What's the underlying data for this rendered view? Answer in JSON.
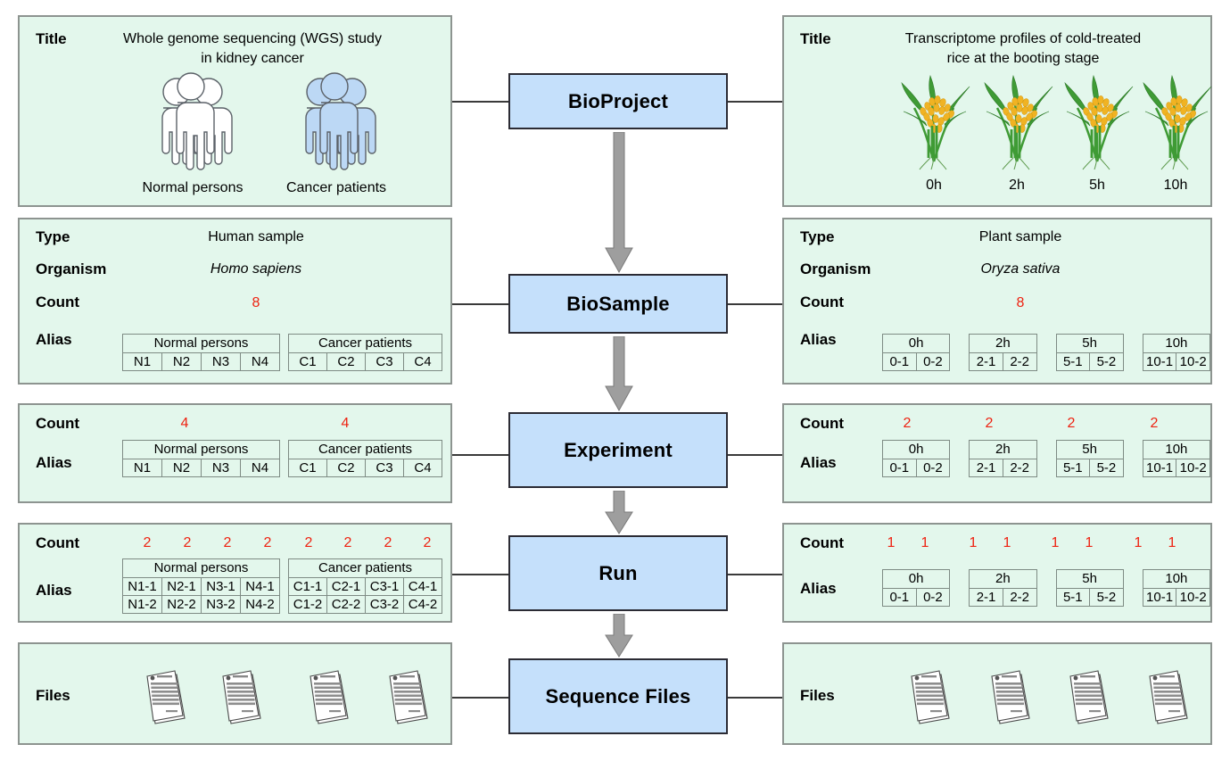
{
  "colors": {
    "panel_bg": "#e3f7ec",
    "panel_border": "#8d9490",
    "stage_box_bg": "#c5e0fb",
    "stage_box_border": "#2b2b34",
    "count_red": "#ee2211",
    "arrow_gray": "#9e9e9e",
    "rice_grain": "#f0b323",
    "rice_leaf": "#3f9b35",
    "person_blue": "#bcd8f5"
  },
  "center_stages": [
    {
      "label": "BioProject"
    },
    {
      "label": "BioSample"
    },
    {
      "label": "Experiment"
    },
    {
      "label": "Run"
    },
    {
      "label": "Sequence Files"
    }
  ],
  "left": {
    "title_row": {
      "label": "Title",
      "value_line1": "Whole genome sequencing (WGS) study",
      "value_line2": "in kidney cancer",
      "groups": [
        {
          "caption": "Normal persons",
          "style": "white"
        },
        {
          "caption": "Cancer patients",
          "style": "blue"
        }
      ]
    },
    "biosample_row": {
      "labels": [
        "Type",
        "Organism",
        "Count",
        "Alias"
      ],
      "type_value": "Human sample",
      "organism_value": "Homo sapiens",
      "counts": [
        "8"
      ],
      "alias_groups": [
        {
          "header": "Normal persons",
          "cells": [
            "N1",
            "N2",
            "N3",
            "N4"
          ]
        },
        {
          "header": "Cancer patients",
          "cells": [
            "C1",
            "C2",
            "C3",
            "C4"
          ]
        }
      ]
    },
    "experiment_row": {
      "labels": [
        "Count",
        "Alias"
      ],
      "counts": [
        "4",
        "4"
      ],
      "alias_groups": [
        {
          "header": "Normal persons",
          "cells": [
            "N1",
            "N2",
            "N3",
            "N4"
          ]
        },
        {
          "header": "Cancer patients",
          "cells": [
            "C1",
            "C2",
            "C3",
            "C4"
          ]
        }
      ]
    },
    "run_row": {
      "labels": [
        "Count",
        "Alias"
      ],
      "counts": [
        "2",
        "2",
        "2",
        "2",
        "2",
        "2",
        "2",
        "2"
      ],
      "alias_groups": [
        {
          "header": "Normal persons",
          "row1": [
            "N1-1",
            "N2-1",
            "N3-1",
            "N4-1"
          ],
          "row2": [
            "N1-2",
            "N2-2",
            "N3-2",
            "N4-2"
          ]
        },
        {
          "header": "Cancer patients",
          "row1": [
            "C1-1",
            "C2-1",
            "C3-1",
            "C4-1"
          ],
          "row2": [
            "C1-2",
            "C2-2",
            "C3-2",
            "C4-2"
          ]
        }
      ]
    },
    "files_row": {
      "label": "Files",
      "file_count": 4
    }
  },
  "right": {
    "title_row": {
      "label": "Title",
      "value_line1": "Transcriptome profiles of cold-treated",
      "value_line2": "rice at the booting stage",
      "timepoints": [
        "0h",
        "2h",
        "5h",
        "10h"
      ]
    },
    "biosample_row": {
      "labels": [
        "Type",
        "Organism",
        "Count",
        "Alias"
      ],
      "type_value": "Plant sample",
      "organism_value": "Oryza sativa",
      "counts": [
        "8"
      ],
      "alias_groups": [
        {
          "header": "0h",
          "cells": [
            "0-1",
            "0-2"
          ]
        },
        {
          "header": "2h",
          "cells": [
            "2-1",
            "2-2"
          ]
        },
        {
          "header": "5h",
          "cells": [
            "5-1",
            "5-2"
          ]
        },
        {
          "header": "10h",
          "cells": [
            "10-1",
            "10-2"
          ]
        }
      ]
    },
    "experiment_row": {
      "labels": [
        "Count",
        "Alias"
      ],
      "counts": [
        "2",
        "2",
        "2",
        "2"
      ],
      "alias_groups": [
        {
          "header": "0h",
          "cells": [
            "0-1",
            "0-2"
          ]
        },
        {
          "header": "2h",
          "cells": [
            "2-1",
            "2-2"
          ]
        },
        {
          "header": "5h",
          "cells": [
            "5-1",
            "5-2"
          ]
        },
        {
          "header": "10h",
          "cells": [
            "10-1",
            "10-2"
          ]
        }
      ]
    },
    "run_row": {
      "labels": [
        "Count",
        "Alias"
      ],
      "counts": [
        "1",
        "1",
        "1",
        "1",
        "1",
        "1",
        "1",
        "1"
      ],
      "alias_groups": [
        {
          "header": "0h",
          "cells": [
            "0-1",
            "0-2"
          ]
        },
        {
          "header": "2h",
          "cells": [
            "2-1",
            "2-2"
          ]
        },
        {
          "header": "5h",
          "cells": [
            "5-1",
            "5-2"
          ]
        },
        {
          "header": "10h",
          "cells": [
            "10-1",
            "10-2"
          ]
        }
      ]
    },
    "files_row": {
      "label": "Files",
      "file_count": 4
    }
  }
}
